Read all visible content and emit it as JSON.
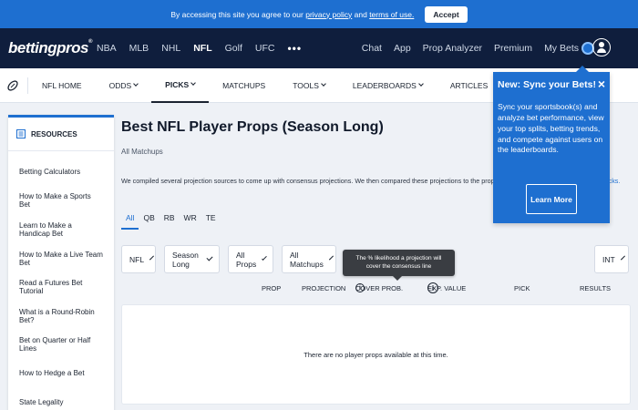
{
  "cookie_bar": {
    "text_before": "By accessing this site you agree to our",
    "privacy_link": "privacy policy",
    "and_text": "and",
    "terms_link": "terms of use.",
    "accept_label": "Accept"
  },
  "header": {
    "logo": "bettingpros",
    "sports": [
      "NBA",
      "MLB",
      "NHL",
      "NFL",
      "Golf",
      "UFC"
    ],
    "active_sport": "NFL",
    "more_label": "•••",
    "right_links": [
      "Chat",
      "App",
      "Prop Analyzer",
      "Premium",
      "My Bets"
    ]
  },
  "subnav": {
    "items": [
      {
        "label": "NFL HOME",
        "dropdown": false,
        "active": false
      },
      {
        "label": "ODDS",
        "dropdown": true,
        "active": false
      },
      {
        "label": "PICKS",
        "dropdown": true,
        "active": true
      },
      {
        "label": "MATCHUPS",
        "dropdown": false,
        "active": false
      },
      {
        "label": "TOOLS",
        "dropdown": true,
        "active": false
      },
      {
        "label": "LEADERBOARDS",
        "dropdown": true,
        "active": false
      },
      {
        "label": "ARTICLES",
        "dropdown": false,
        "active": false
      },
      {
        "label": "TEAMS",
        "dropdown": false,
        "active": false
      },
      {
        "label": "PODCAST",
        "dropdown": false,
        "active": false
      }
    ]
  },
  "sidebar": {
    "heading": "RESOURCES",
    "items": [
      "Betting Calculators",
      "How to Make a Sports Bet",
      "Learn to Make a Handicap Bet",
      "How to Make a Live Team Bet",
      "Read a Futures Bet Tutorial",
      "What is a Round-Robin Bet?",
      "Bet on Quarter or Half Lines",
      "How to Hedge a Bet",
      "State Legality"
    ]
  },
  "main": {
    "title": "Best NFL Player Props (Season Long)",
    "subtitle": "All Matchups",
    "description": "We compiled several projection sources to come up with consensus projections. We then compared these projections to the prop bet odds from the",
    "description_end": "icks.",
    "position_tabs": [
      "All",
      "QB",
      "RB",
      "WR",
      "TE"
    ],
    "filters": {
      "league": "NFL",
      "period": "Season Long",
      "props": "All Props",
      "matchups": "All Matchups",
      "odds_format": "INT"
    },
    "tooltip": "The % likelihood a projection will cover the consensus line",
    "columns": [
      "PROP",
      "PROJECTION",
      "COVER PROB.",
      "EXP. VALUE",
      "PICK",
      "RESULTS"
    ],
    "info_icon": "i",
    "empty_message": "There are no player props available at this time."
  },
  "popover": {
    "title": "New: Sync your Bets!",
    "close": "×",
    "body": "Sync your sportsbook(s) and analyze bet performance, view your top splits, betting trends, and compete against users on the leaderboards.",
    "button_label": "Learn More"
  },
  "colors": {
    "brand_blue": "#1e6fd0",
    "navy": "#0f1e3d",
    "background": "#eef1f6"
  }
}
